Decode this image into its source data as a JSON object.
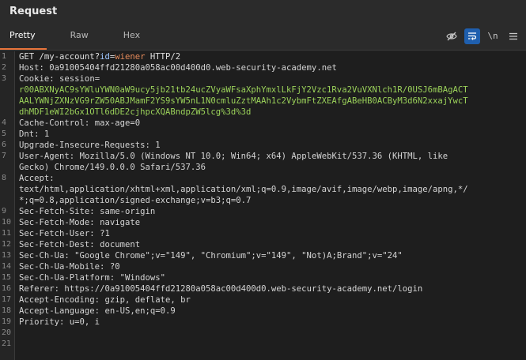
{
  "title": "Request",
  "tabs": [
    {
      "label": "Pretty",
      "active": true
    },
    {
      "label": "Raw",
      "active": false
    },
    {
      "label": "Hex",
      "active": false
    }
  ],
  "toolbar": {
    "hide_icon": "eye-slash-icon",
    "wrap_icon": "word-wrap-icon",
    "newline_label": "\\n",
    "menu_icon": "hamburger-menu-icon"
  },
  "request": {
    "line1": {
      "method": "GET",
      "path_prefix": "/my-account?",
      "param_name": "id",
      "equals": "=",
      "param_value": "wiener",
      "version": "HTTP/2"
    },
    "host": {
      "name": "Host:",
      "value": "0a91005404ffd21280a058ac00d400d0.web-security-academy.net"
    },
    "cookie": {
      "name": "Cookie:",
      "cookie_name": "session=",
      "value_line1": "r00ABXNyAC9sYWluYWN0aW9ucy5jb21tb24ucZVyaWFsaXphYmxlLkFjY2Vzc1Rva2VuVXNlch1R/0USJ6mBAgACT",
      "value_line2": "AALYWNjZXNzVG9rZW50ABJMamF2YS9sYW5nL1N0cmluZztMAAh1c2VybmFtZXEAfgABeHB0ACByM3d6N2xxajYwcT",
      "value_line3": "dhMDF1eWI2bGx1OTl6dDE2cjhpcXQABndpZW5lcg%3d%3d"
    },
    "cache_control": {
      "name": "Cache-Control:",
      "value": "max-age=0"
    },
    "dnt": {
      "name": "Dnt:",
      "value": "1"
    },
    "upgrade": {
      "name": "Upgrade-Insecure-Requests:",
      "value": "1"
    },
    "user_agent": {
      "name": "User-Agent:",
      "value_line1": "Mozilla/5.0 (Windows NT 10.0; Win64; x64) AppleWebKit/537.36 (KHTML, like",
      "value_line2": "Gecko) Chrome/149.0.0.0 Safari/537.36"
    },
    "accept": {
      "name": "Accept:",
      "value_line1": "text/html,application/xhtml+xml,application/xml;q=0.9,image/avif,image/webp,image/apng,*/",
      "value_line2": "*;q=0.8,application/signed-exchange;v=b3;q=0.7"
    },
    "sec_fetch_site": {
      "name": "Sec-Fetch-Site:",
      "value": "same-origin"
    },
    "sec_fetch_mode": {
      "name": "Sec-Fetch-Mode:",
      "value": "navigate"
    },
    "sec_fetch_user": {
      "name": "Sec-Fetch-User:",
      "value": "?1"
    },
    "sec_fetch_dest": {
      "name": "Sec-Fetch-Dest:",
      "value": "document"
    },
    "sec_ch_ua": {
      "name": "Sec-Ch-Ua:",
      "value": "\"Google Chrome\";v=\"149\", \"Chromium\";v=\"149\", \"Not)A;Brand\";v=\"24\""
    },
    "sec_ch_ua_mobile": {
      "name": "Sec-Ch-Ua-Mobile:",
      "value": "?0"
    },
    "sec_ch_ua_platform": {
      "name": "Sec-Ch-Ua-Platform:",
      "value": "\"Windows\""
    },
    "referer": {
      "name": "Referer:",
      "value": "https://0a91005404ffd21280a058ac00d400d0.web-security-academy.net/login"
    },
    "accept_encoding": {
      "name": "Accept-Encoding:",
      "value": "gzip, deflate, br"
    },
    "accept_language": {
      "name": "Accept-Language:",
      "value": "en-US,en;q=0.9"
    },
    "priority": {
      "name": "Priority:",
      "value": "u=0, i"
    }
  },
  "line_numbers": [
    "1",
    "2",
    "3",
    "4",
    "5",
    "6",
    "7",
    "8",
    "9",
    "10",
    "11",
    "12",
    "13",
    "14",
    "15",
    "16",
    "17",
    "18",
    "19",
    "20",
    "21"
  ],
  "colors": {
    "accent": "#e8743b",
    "active_tool": "#1f5fae",
    "cookie_value": "#9bd25a"
  }
}
